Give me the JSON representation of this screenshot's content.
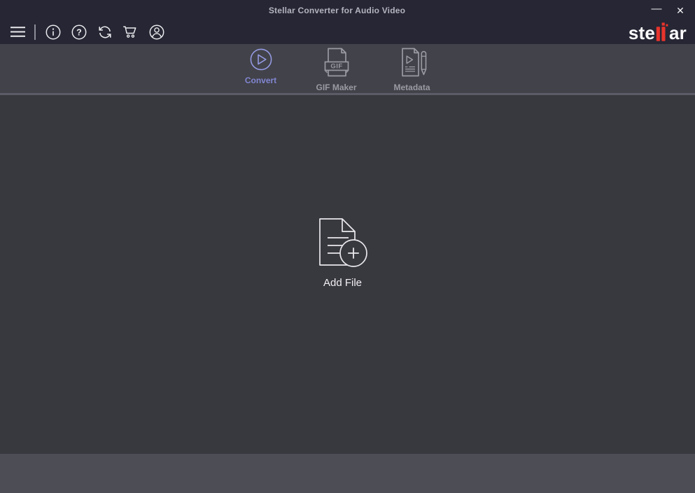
{
  "window": {
    "title": "Stellar Converter for Audio Video",
    "minimize_glyph": "—",
    "close_glyph": "✕"
  },
  "toolbar": {
    "icons": [
      {
        "name": "hamburger-menu-icon"
      },
      {
        "name": "info-icon"
      },
      {
        "name": "help-icon",
        "glyph": "?"
      },
      {
        "name": "refresh-icon"
      },
      {
        "name": "cart-icon"
      },
      {
        "name": "account-icon"
      }
    ],
    "logo": {
      "pre": "ste",
      "post": "ar",
      "red": "#e8342c"
    }
  },
  "tabs": [
    {
      "label": "Convert",
      "icon": "play-circle-icon",
      "active": true
    },
    {
      "label": "GIF Maker",
      "icon": "gif-document-icon",
      "icon_text": "GIF",
      "active": false
    },
    {
      "label": "Metadata",
      "icon": "document-edit-icon",
      "active": false
    }
  ],
  "main": {
    "add_file_label": "Add File",
    "add_file_icon": "add-file-icon"
  },
  "colors": {
    "header_bg": "#262634",
    "tabbar_bg": "#42424a",
    "main_bg": "#38383f",
    "footer_bg": "#4d4d56",
    "accent": "#8186d2",
    "inactive_gray": "#9a9aa3",
    "toolbar_icon": "#eaeaee",
    "logo_red": "#e8342c"
  }
}
